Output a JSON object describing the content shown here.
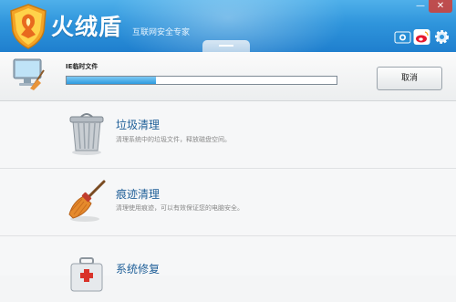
{
  "app": {
    "title": "火绒盾",
    "subtitle": "互联网安全专家"
  },
  "window": {
    "minimize_label": "—",
    "close_label": "✕"
  },
  "header_icons": [
    "camera-icon",
    "weibo-icon",
    "settings-gear-icon"
  ],
  "task": {
    "label": "IE临时文件",
    "progress": 0.33,
    "cancel_label": "取消"
  },
  "features": [
    {
      "icon": "trash-can-icon",
      "title": "垃圾清理",
      "desc": "清理系统中的垃圾文件，释放磁盘空间。"
    },
    {
      "icon": "broom-icon",
      "title": "痕迹清理",
      "desc": "清理使用痕迹，可以有效保证您的电脑安全。"
    },
    {
      "icon": "toolbox-icon",
      "title": "系统修复",
      "desc": ""
    }
  ],
  "colors": {
    "titlebar": "#2f95dc",
    "feature_title": "#1f5f98",
    "progress_fill": "#2c9be0"
  }
}
